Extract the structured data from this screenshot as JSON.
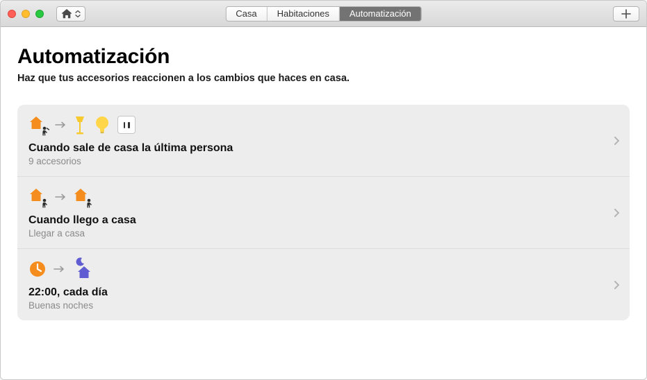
{
  "toolbar": {
    "tabs": [
      "Casa",
      "Habitaciones",
      "Automatización"
    ],
    "active_index": 2
  },
  "page": {
    "title": "Automatización",
    "subtitle": "Haz que tus accesorios reaccionen a los cambios que haces en casa."
  },
  "automations": [
    {
      "title": "Cuando sale de casa la última persona",
      "subtitle": "9 accesorios",
      "trigger": "leave-home",
      "actions": [
        "floor-lamp",
        "bulb",
        "outlet"
      ]
    },
    {
      "title": "Cuando llego a casa",
      "subtitle": "Llegar a casa",
      "trigger": "arrive-home",
      "actions": [
        "arrive-home"
      ]
    },
    {
      "title": "22:00, cada día",
      "subtitle": "Buenas noches",
      "trigger": "time",
      "actions": [
        "night-home"
      ]
    }
  ],
  "colors": {
    "orange": "#f58d1e",
    "yellow": "#f6c92e",
    "yellow_light": "#ffd54a",
    "indigo": "#5f5dd1",
    "dark": "#2e2e2e"
  }
}
